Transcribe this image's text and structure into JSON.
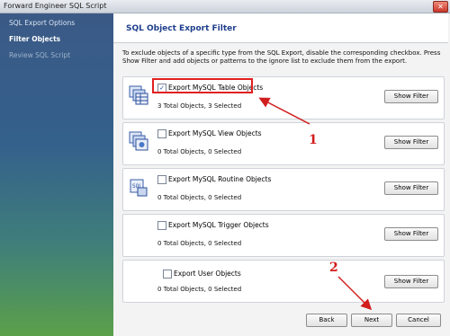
{
  "window": {
    "title": "Forward Engineer SQL Script",
    "close_glyph": "✕"
  },
  "sidebar": {
    "items": [
      {
        "label": "SQL Export Options",
        "state": "normal"
      },
      {
        "label": "Filter Objects",
        "state": "active"
      },
      {
        "label": "Review SQL Script",
        "state": "disabled"
      }
    ]
  },
  "header": {
    "title": "SQL Object Export Filter"
  },
  "description": "To exclude objects of a specific type from the SQL Export, disable the corresponding checkbox. Press Show Filter and add objects or patterns to the ignore list to exclude them from the export.",
  "panels": [
    {
      "label": "Export MySQL Table Objects",
      "count": "3 Total Objects, 3 Selected",
      "checked": true,
      "button": "Show Filter",
      "icon": "table-objects-icon"
    },
    {
      "label": "Export MySQL View Objects",
      "count": "0 Total Objects, 0 Selected",
      "checked": false,
      "button": "Show Filter",
      "icon": "view-objects-icon"
    },
    {
      "label": "Export MySQL Routine Objects",
      "count": "0 Total Objects, 0 Selected",
      "checked": false,
      "button": "Show Filter",
      "icon": "routine-objects-icon"
    },
    {
      "label": "Export MySQL Trigger Objects",
      "count": "0 Total Objects, 0 Selected",
      "checked": false,
      "button": "Show Filter",
      "icon": ""
    },
    {
      "label": "Export User Objects",
      "count": "0 Total Objects, 0 Selected",
      "checked": false,
      "button": "Show Filter",
      "icon": ""
    }
  ],
  "footer": {
    "back": "Back",
    "next": "Next",
    "cancel": "Cancel"
  },
  "annotations": {
    "marker_1": "1",
    "marker_2": "2",
    "color": "#d11d1d"
  }
}
